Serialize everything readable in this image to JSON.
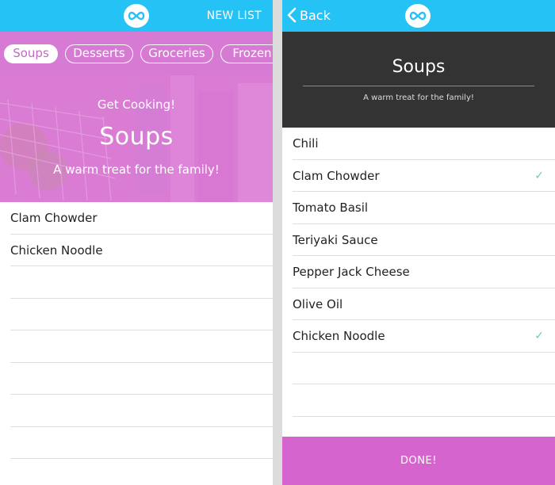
{
  "left": {
    "nav": {
      "new_list": "NEW LIST"
    },
    "tabs": [
      {
        "label": "Soups"
      },
      {
        "label": "Desserts"
      },
      {
        "label": "Groceries"
      },
      {
        "label": "Frozen"
      }
    ],
    "hero": {
      "subtitle": "Get Cooking!",
      "title": "Soups",
      "description": "A warm treat for the family!"
    },
    "items": [
      {
        "label": "Clam Chowder"
      },
      {
        "label": "Chicken Noodle"
      }
    ]
  },
  "right": {
    "nav": {
      "back": "Back"
    },
    "header": {
      "title": "Soups",
      "description": "A warm treat for the family!"
    },
    "items": [
      {
        "label": "Chili",
        "checked": false
      },
      {
        "label": "Clam Chowder",
        "checked": true
      },
      {
        "label": "Tomato Basil",
        "checked": false
      },
      {
        "label": "Teriyaki Sauce",
        "checked": false
      },
      {
        "label": "Pepper Jack Cheese",
        "checked": false
      },
      {
        "label": "Olive Oil",
        "checked": false
      },
      {
        "label": "Chicken Noodle",
        "checked": true
      }
    ],
    "done_label": "DONE!"
  },
  "icons": {
    "logo": "infinity-logo-icon",
    "back": "chevron-left-icon",
    "check": "checkmark-icon",
    "check_glyph": "✓"
  },
  "colors": {
    "nav_blue": "#24c2f5",
    "tabs_pink": "#d77ad3",
    "done_pink": "#d664cf",
    "header_dark": "#333333",
    "check_green": "#5fd2b1"
  }
}
